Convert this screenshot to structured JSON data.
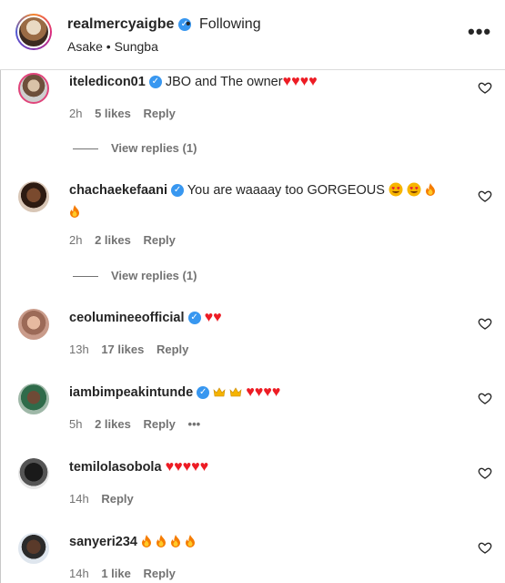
{
  "header": {
    "username": "realmercyaigbe",
    "separator": "•",
    "follow_label": "Following",
    "subtitle": "Asake • Sungba",
    "more_label": "•••"
  },
  "comments": [
    {
      "username": "iteledicon01",
      "verified": true,
      "text": "JBO and The owner",
      "emoji_tail": "♥♥♥♥",
      "time": "2h",
      "likes": "5 likes",
      "reply": "Reply",
      "view_replies": "View replies (1)"
    },
    {
      "username": "chachaekefaani",
      "verified": true,
      "text": "You are waaaay too GORGEOUS",
      "time": "2h",
      "likes": "2 likes",
      "reply": "Reply",
      "view_replies": "View replies (1)"
    },
    {
      "username": "ceolumineeofficial",
      "verified": true,
      "text": "",
      "emoji_tail": "♥♥",
      "time": "13h",
      "likes": "17 likes",
      "reply": "Reply"
    },
    {
      "username": "iambimpeakintunde",
      "verified": true,
      "text": "",
      "emoji_tail": "♥♥♥♥",
      "time": "5h",
      "likes": "2 likes",
      "reply": "Reply",
      "more": "•••"
    },
    {
      "username": "temilolasobola",
      "verified": false,
      "text": "",
      "emoji_tail": "♥♥♥♥♥",
      "time": "14h",
      "reply": "Reply"
    },
    {
      "username": "sanyeri234",
      "verified": false,
      "text": "",
      "time": "14h",
      "likes": "1 like",
      "reply": "Reply"
    }
  ],
  "colors": {
    "verified": "#3897f0",
    "heart": "#ed1c24",
    "muted": "#737373"
  }
}
